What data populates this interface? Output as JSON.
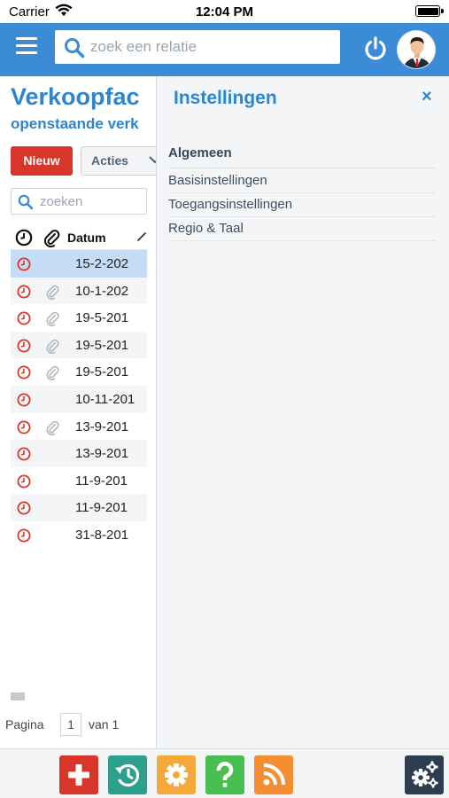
{
  "status_bar": {
    "carrier": "Carrier",
    "time": "12:04 PM"
  },
  "header": {
    "search_placeholder": "zoek een relatie"
  },
  "left_panel": {
    "title": "Verkoopfac",
    "subtitle": "openstaande verk",
    "new_button": "Nieuw",
    "actions_button": "Acties",
    "search_placeholder": "zoeken",
    "date_column": "Datum",
    "rows": [
      {
        "date": "15-2-202",
        "attachment": false,
        "selected": true
      },
      {
        "date": "10-1-202",
        "attachment": true,
        "selected": false
      },
      {
        "date": "19-5-201",
        "attachment": true,
        "selected": false
      },
      {
        "date": "19-5-201",
        "attachment": true,
        "selected": false
      },
      {
        "date": "19-5-201",
        "attachment": true,
        "selected": false
      },
      {
        "date": "10-11-201",
        "attachment": false,
        "selected": false
      },
      {
        "date": "13-9-201",
        "attachment": true,
        "selected": false
      },
      {
        "date": "13-9-201",
        "attachment": false,
        "selected": false
      },
      {
        "date": "11-9-201",
        "attachment": false,
        "selected": false
      },
      {
        "date": "11-9-201",
        "attachment": false,
        "selected": false
      },
      {
        "date": "31-8-201",
        "attachment": false,
        "selected": false
      }
    ],
    "pagination": {
      "label": "Pagina",
      "current": "1",
      "of_label": "van 1"
    }
  },
  "settings_panel": {
    "title": "Instellingen",
    "close_symbol": "×",
    "section": "Algemeen",
    "items": [
      "Basisinstellingen",
      "Toegangsinstellingen",
      "Regio & Taal"
    ]
  },
  "toolbar": {
    "buttons": [
      {
        "name": "add",
        "icon": "plus-icon",
        "color": "#d9362b"
      },
      {
        "name": "history",
        "icon": "history-icon",
        "color": "#2ca08c"
      },
      {
        "name": "settings",
        "icon": "gear-icon",
        "color": "#f6a93b"
      },
      {
        "name": "help",
        "icon": "question-icon",
        "color": "#49bf52"
      },
      {
        "name": "rss",
        "icon": "rss-icon",
        "color": "#f38e32"
      },
      {
        "name": "gears",
        "icon": "gears-icon",
        "color": "#2d3e50"
      }
    ]
  },
  "colors": {
    "accent": "#3b8bd6",
    "title_blue": "#2b86cf",
    "danger": "#d9362b"
  }
}
